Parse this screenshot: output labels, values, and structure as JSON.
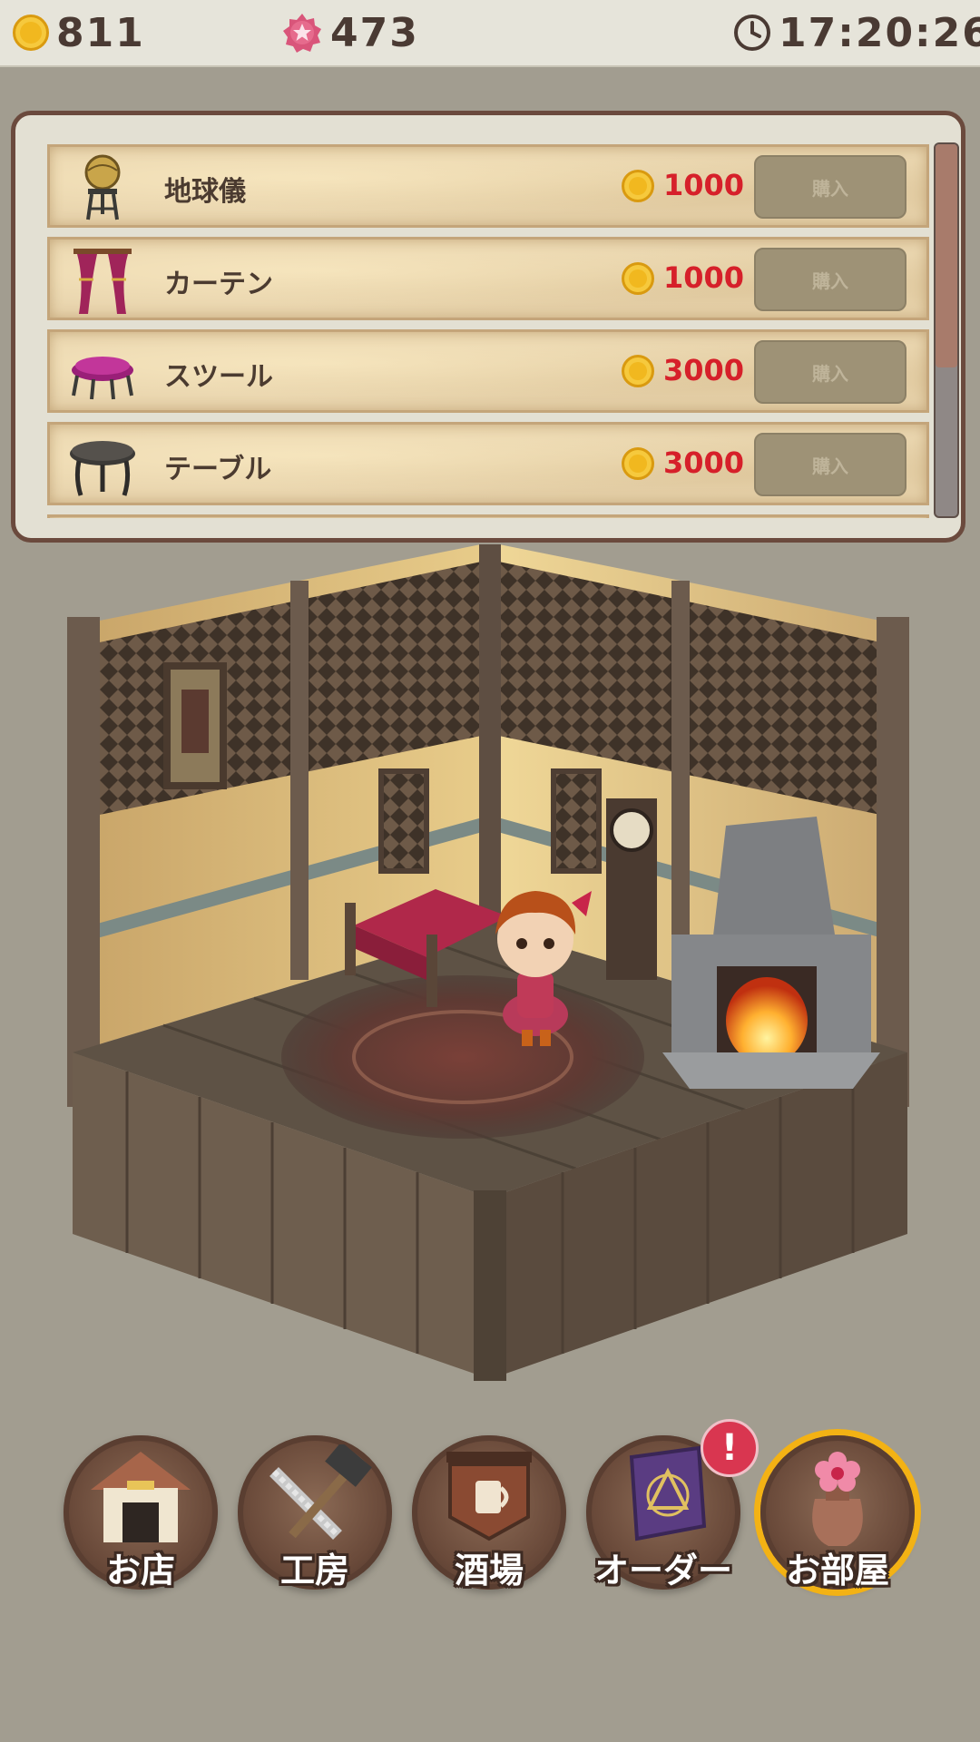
{
  "status": {
    "coins": "811",
    "stars": "473",
    "time": "17:20:26"
  },
  "shop": {
    "items": [
      {
        "name": "地球儀",
        "price": "1000",
        "buy_label": "購入",
        "icon": "globe-icon"
      },
      {
        "name": "カーテン",
        "price": "1000",
        "buy_label": "購入",
        "icon": "curtain-icon"
      },
      {
        "name": "スツール",
        "price": "3000",
        "buy_label": "購入",
        "icon": "stool-icon"
      },
      {
        "name": "テーブル",
        "price": "3000",
        "buy_label": "購入",
        "icon": "table-icon"
      }
    ],
    "scroll_fraction": 0.6
  },
  "nav": {
    "items": [
      {
        "label": "お店",
        "icon": "shop-icon",
        "active": false
      },
      {
        "label": "工房",
        "icon": "workshop-icon",
        "active": false
      },
      {
        "label": "酒場",
        "icon": "tavern-icon",
        "active": false
      },
      {
        "label": "オーダー",
        "icon": "order-book-icon",
        "active": false
      },
      {
        "label": "お部屋",
        "icon": "room-vase-icon",
        "active": true
      }
    ],
    "order_badge": "!"
  },
  "colors": {
    "price": "#d6202a",
    "accent": "#f3b214",
    "badge": "#d93650"
  }
}
